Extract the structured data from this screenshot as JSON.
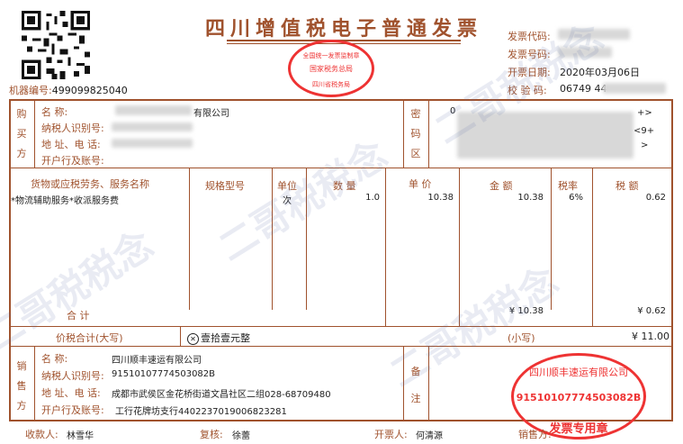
{
  "header": {
    "title": "四川增值税电子普通发票",
    "seal_top": {
      "line1": "全国统一发票监制章",
      "line2": "国家税务总局",
      "line3": "四川省税务局"
    },
    "machine_label": "机器编号:",
    "machine_no": "499099825040",
    "invoice_code_label": "发票代码:",
    "invoice_no_label": "发票号码:",
    "date_label": "开票日期:",
    "date": "2020年03月06日",
    "check_label": "校 验 码:",
    "check_code": "06749 44"
  },
  "buyer": {
    "side_label": "购买方",
    "name_label": "名    称:",
    "name_value": "有限公司",
    "tax_id_label": "纳税人识别号:",
    "address_label": "地 址、电 话:",
    "bank_label": "开户行及账号:",
    "cipher_label": "密码区",
    "cipher_fragments": [
      "0",
      "+>",
      "<9+",
      ">"
    ]
  },
  "items": {
    "headers": {
      "name": "货物或应税劳务、服务名称",
      "spec": "规格型号",
      "unit": "单位",
      "qty": "数 量",
      "price": "单 价",
      "amount": "金 额",
      "rate": "税率",
      "tax": "税 额"
    },
    "rows": [
      {
        "name": "*物流辅助服务*收派服务费",
        "spec": "",
        "unit": "次",
        "qty": "1.0",
        "price": "10.38",
        "amount": "10.38",
        "rate": "6%",
        "tax": "0.62"
      }
    ],
    "total_label": "合          计",
    "total_amount": "¥ 10.38",
    "total_tax": "¥ 0.62"
  },
  "sum": {
    "label": "价税合计(大写)",
    "upper_symbol": "⊗",
    "upper_text": "壹拾壹元整",
    "lower_label": "(小写)",
    "lower_value": "¥ 11.00"
  },
  "seller": {
    "side_label": "销售方",
    "name_label": "名    称:",
    "name_value": "四川顺丰速运有限公司",
    "tax_id_label": "纳税人识别号:",
    "tax_id_value": "91510107774503082B",
    "address_label": "地 址、电 话:",
    "address_value": "成都市武侯区金花桥街道文昌社区二组028-68709480",
    "bank_label": "开户行及账号:",
    "bank_value": "工行花牌坊支行4402237019006823281",
    "remark_label": "备注",
    "seal": {
      "name": "四川顺丰速运有限公司",
      "number": "91510107774503082B",
      "label": "发票专用章"
    }
  },
  "footer": {
    "payee_label": "收款人:",
    "payee": "林雪华",
    "reviewer_label": "复核:",
    "reviewer": "徐蕾",
    "drawer_label": "开票人:",
    "drawer": "何清源",
    "seller_sign_label": "销售方:"
  },
  "watermark": {
    "text": "二哥税税念"
  },
  "colors": {
    "frame": "#a0522d",
    "seal": "#e33333",
    "watermark": "#5a6ea8"
  }
}
